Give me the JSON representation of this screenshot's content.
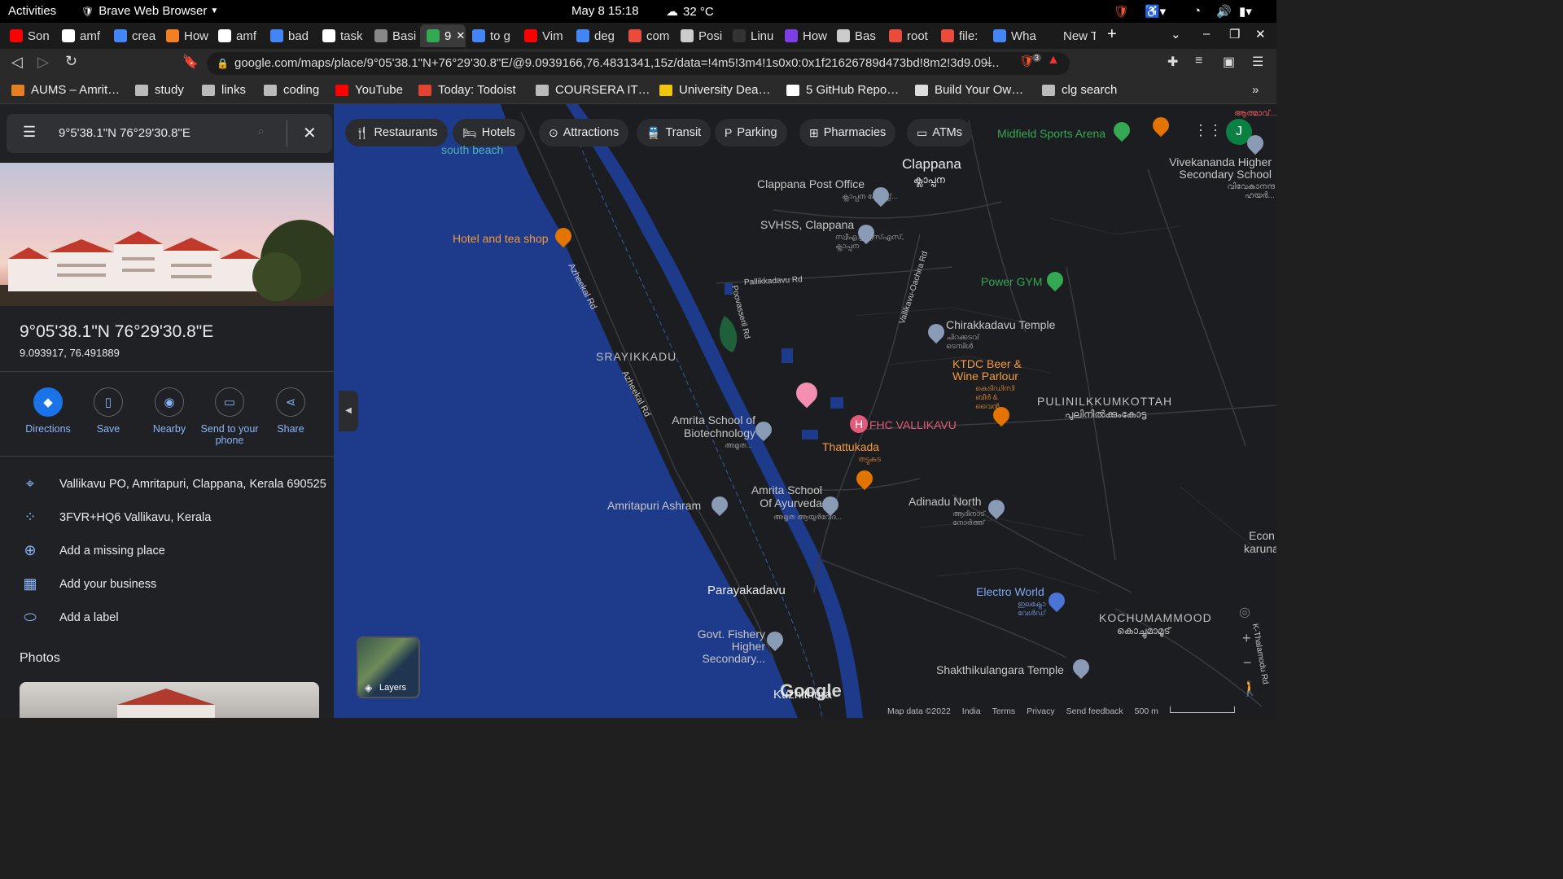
{
  "os_bar": {
    "activities": "Activities",
    "browser_name": "Brave Web Browser",
    "datetime": "May 8  15:18",
    "weather": "32 °C"
  },
  "tabs": [
    {
      "label": "Son",
      "color": "#ff0000"
    },
    {
      "label": "amf",
      "color": "#ffffff"
    },
    {
      "label": "crea",
      "color": "#4285f4"
    },
    {
      "label": "How",
      "color": "#f48024"
    },
    {
      "label": "amf",
      "color": "#ffffff"
    },
    {
      "label": "bad",
      "color": "#4285f4"
    },
    {
      "label": "task",
      "color": "#ffffff"
    },
    {
      "label": "Basi",
      "color": "#888888"
    },
    {
      "label": "9",
      "color": "#34a853",
      "active": true
    },
    {
      "label": "to g",
      "color": "#4285f4"
    },
    {
      "label": "Vim",
      "color": "#ff0000"
    },
    {
      "label": "deg",
      "color": "#4285f4"
    },
    {
      "label": "com",
      "color": "#e74c3c"
    },
    {
      "label": "Posi",
      "color": "#cccccc"
    },
    {
      "label": "Linu",
      "color": "#333333"
    },
    {
      "label": "How",
      "color": "#7b3fe4"
    },
    {
      "label": "Bas",
      "color": "#cccccc"
    },
    {
      "label": "root",
      "color": "#e74c3c"
    },
    {
      "label": "file:",
      "color": "#e74c3c"
    },
    {
      "label": "Wha",
      "color": "#4285f4"
    },
    {
      "label": "New Ta",
      "color": "#1b1b1b"
    }
  ],
  "address": {
    "url": "google.com/maps/place/9°05'38.1\"N+76°29'30.8\"E/@9.0939166,76.4831341,15z/data=!4m5!3m4!1s0x0:0x1f21626789d473bd!8m2!3d9.09…",
    "shield_count": "3"
  },
  "bookmarks": [
    {
      "label": "AUMS – Amrit…",
      "color": "#e67e22"
    },
    {
      "label": "study",
      "color": "#bbbbbb"
    },
    {
      "label": "links",
      "color": "#bbbbbb"
    },
    {
      "label": "coding",
      "color": "#bbbbbb"
    },
    {
      "label": "YouTube",
      "color": "#ff0000"
    },
    {
      "label": "Today: Todoist",
      "color": "#e44332"
    },
    {
      "label": "COURSERA IT…",
      "color": "#bbbbbb"
    },
    {
      "label": "University Dea…",
      "color": "#f1c40f"
    },
    {
      "label": "5 GitHub Repo…",
      "color": "#ffffff"
    },
    {
      "label": "Build Your Ow…",
      "color": "#dddddd"
    },
    {
      "label": "clg search",
      "color": "#bbbbbb"
    }
  ],
  "panel": {
    "search_value": "9°5'38.1\"N 76°29'30.8\"E",
    "title": "9°05'38.1\"N 76°29'30.8\"E",
    "decimal": "9.093917, 76.491889",
    "actions": [
      {
        "label": "Directions",
        "icon": "directions-icon"
      },
      {
        "label": "Save",
        "icon": "bookmark-icon"
      },
      {
        "label": "Nearby",
        "icon": "nearby-icon"
      },
      {
        "label": "Send to your phone",
        "icon": "phone-icon"
      },
      {
        "label": "Share",
        "icon": "share-icon"
      }
    ],
    "info_rows": [
      {
        "text": "Vallikavu PO, Amritapuri, Clappana, Kerala 690525",
        "icon": "location-pin-icon"
      },
      {
        "text": "3FVR+HQ6 Vallikavu, Kerala",
        "icon": "plus-code-icon"
      },
      {
        "text": "Add a missing place",
        "icon": "add-place-icon"
      },
      {
        "text": "Add your business",
        "icon": "business-icon"
      },
      {
        "text": "Add a label",
        "icon": "label-icon"
      }
    ],
    "photos_heading": "Photos"
  },
  "map": {
    "chips": [
      {
        "label": "Restaurants",
        "icon": "fork-knife-icon"
      },
      {
        "label": "Hotels",
        "icon": "bed-icon"
      },
      {
        "label": "Attractions",
        "icon": "camera-icon"
      },
      {
        "label": "Transit",
        "icon": "train-icon"
      },
      {
        "label": "Parking",
        "icon": "parking-icon"
      },
      {
        "label": "Pharmacies",
        "icon": "pharmacy-icon"
      },
      {
        "label": "ATMs",
        "icon": "atm-icon"
      }
    ],
    "avatar": "J",
    "places": {
      "midfield": "Midfield Sports Arena",
      "clappana": "Clappana",
      "clappana_ml": "ക്ലാപ്പന",
      "post_office": "Clappana Post Office",
      "post_office_ml": "ക്ലാപ്പന പോസ്റ്റ്...",
      "svhss": "SVHSS, Clappana",
      "svhss_ml": "സ്വീഎച്ച്എസ്എസ്, ക്ലാപ്പന",
      "south_beach": "south beach",
      "hotel_tea": "Hotel and tea shop",
      "vivekananda": "Vivekananda Higher Secondary School",
      "vivekananda_ml": "വിവേകാനന്ദ ഹയർ...",
      "power_gym": "Power GYM",
      "chirakkadavu": "Chirakkadavu Temple",
      "chirakkadavu_ml": "ചിറക്കടവ് ടെമ്പിൾ",
      "ktdc": "KTDC Beer & Wine Parlour",
      "ktdc_ml": "കെടിഡിസി ബീർ & വൈൻ...",
      "srayikkadu": "SRAYIKKADU",
      "pulinilkkumkottah": "PULINILKKUMKOTTAH",
      "pulinilkkumkottah_ml": "പുലിനിൽക്കുംകോട്ട",
      "biotech": "Amrita School of Biotechnology",
      "biotech_ml": "അമൃത...",
      "fhc": "FHC VALLIKAVU",
      "thattukada": "Thattukada",
      "thattukada_ml": "തട്ടുകട",
      "ashram": "Amritapuri Ashram",
      "ayurveda": "Amrita School Of Ayurveda",
      "ayurveda_ml": "അമൃത ആയുർവേദ...",
      "adinadu": "Adinadu North",
      "adinadu_ml": "ആദിനാട് നോർത്ത്",
      "parayakadavu": "Parayakadavu",
      "fishery": "Govt. Fishery Higher Secondary...",
      "electro": "Electro World",
      "electro_ml": "ഇലക്ട്രോ വേൾഡ്",
      "kochumammood": "KOCHUMAMMOOD",
      "kochumammood_ml": "കൊച്ചുമാമൂട്",
      "shakthikulangara": "Shakthikulangara Temple",
      "kuzhithura": "Kuzhithura",
      "econ": "Econ",
      "karuna": "karuna",
      "top_right_ml": "ആത്മാവ്...",
      "azheekal_rd": "Azheekal Rd",
      "pallikkadavu_rd": "Pallikkadavu Rd",
      "vallikavu_rd": "Vallikavu-Oachira Rd",
      "poovasseril_rd": "Poovasseril Rd",
      "kuzhithura_rd": "K-Thalamodu Rd"
    },
    "layers_label": "Layers",
    "footer": {
      "map_data": "Map data ©2022",
      "country": "India",
      "terms": "Terms",
      "privacy": "Privacy",
      "feedback": "Send feedback",
      "scale": "500 m"
    },
    "brand": "Google",
    "colors": {
      "water": "#1e3a8a",
      "land": "#1c1d20",
      "accent": "#8ab4f8",
      "pin": "#f48fb1"
    }
  }
}
